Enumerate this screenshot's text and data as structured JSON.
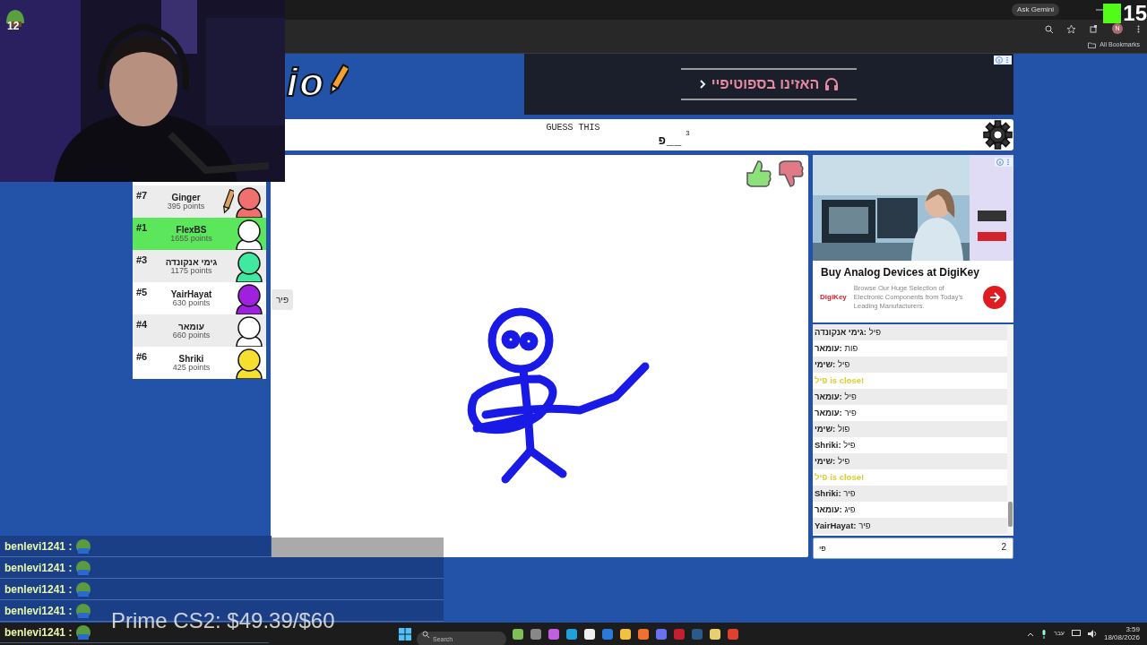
{
  "browser": {
    "gemini_button": "Ask Gemini",
    "profile": "N",
    "bookmarks": "All Bookmarks"
  },
  "overlay": {
    "channel_badge": "12",
    "counter": "15",
    "donation_goal": "Prime CS2: $49.39/$60",
    "stream_chat": [
      {
        "user": "benlevi1241 :"
      },
      {
        "user": "benlevi1241 :"
      },
      {
        "user": "benlevi1241 :"
      },
      {
        "user": "benlevi1241 :"
      },
      {
        "user": "benlevi1241 :"
      }
    ]
  },
  "game": {
    "logo": "io",
    "banner_ad": {
      "text": "האזינו בספוטיפיי"
    },
    "header": {
      "label": "GUESS THIS",
      "letter_count": "3",
      "hint": "פ__"
    },
    "players": [
      {
        "rank": "#7",
        "name": "Ginger",
        "points": "395 points",
        "color": "#f07070",
        "selected": false,
        "drawing": true
      },
      {
        "rank": "#1",
        "name": "FlexBS",
        "points": "1655 points",
        "color": "#ffffff",
        "selected": true,
        "drawing": false
      },
      {
        "rank": "#3",
        "name": "גימי אנקונדה",
        "points": "1175 points",
        "color": "#40e8a0",
        "selected": false,
        "drawing": false
      },
      {
        "rank": "#5",
        "name": "YairHayat",
        "points": "630 points",
        "color": "#a020e0",
        "selected": false,
        "drawing": false,
        "bubble": "פיר"
      },
      {
        "rank": "#4",
        "name": "עומאר",
        "points": "660 points",
        "color": "#ffffff",
        "selected": false,
        "drawing": false
      },
      {
        "rank": "#6",
        "name": "Shriki",
        "points": "425 points",
        "color": "#f5e030",
        "selected": false,
        "drawing": false
      }
    ],
    "ad": {
      "title": "Buy Analog Devices at DigiKey",
      "brand": "DigiKey",
      "description": "Browse Our Huge Selection of Electronic Components from Today's Leading Manufacturers."
    },
    "chat": [
      {
        "kind": "message",
        "text": "**גימי אנקונדה:** פיל"
      },
      {
        "kind": "message",
        "text": "**עומאר:** פות"
      },
      {
        "kind": "message",
        "text": "**שימי:** פיל"
      },
      {
        "kind": "close",
        "text": "פיל is close!"
      },
      {
        "kind": "message",
        "text": "**עומאר:** פיל"
      },
      {
        "kind": "message",
        "text": "**עומאר:** פיר"
      },
      {
        "kind": "message",
        "text": "**שימי:** פול"
      },
      {
        "kind": "message",
        "text": "**Shriki:** פיל"
      },
      {
        "kind": "message",
        "text": "**שימי:** פיל"
      },
      {
        "kind": "close",
        "text": "פיל is close!"
      },
      {
        "kind": "message",
        "text": "**Shriki:** פיר"
      },
      {
        "kind": "message",
        "text": "**עומאר:** פיג"
      },
      {
        "kind": "message",
        "text": "**YairHayat:** פיר"
      }
    ],
    "chat_input": {
      "value": "פי",
      "count": "2"
    }
  },
  "taskbar": {
    "search": {
      "placeholder": "Search"
    },
    "language": "עבר",
    "time": "3:59",
    "date": "18/08/2026"
  }
}
